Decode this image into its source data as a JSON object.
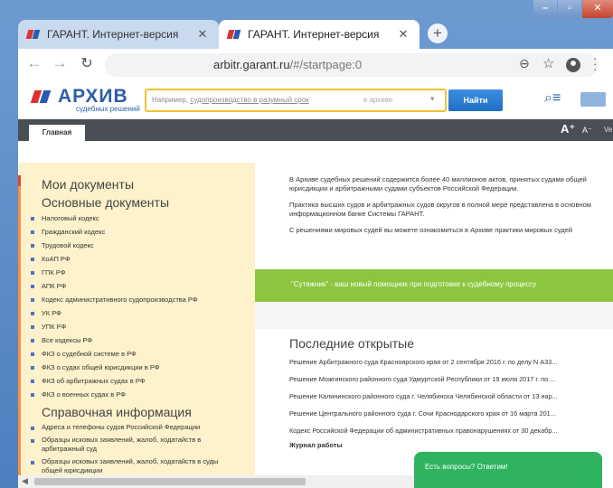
{
  "browser": {
    "tabs": [
      {
        "title": "ГАРАНТ. Интернет-версия",
        "active": false
      },
      {
        "title": "ГАРАНТ. Интернет-версия",
        "active": true
      }
    ],
    "close_glyph": "✕",
    "new_tab_glyph": "+",
    "url_host": "arbitr.garant.ru",
    "url_path": "/#/startpage:0"
  },
  "site": {
    "logo_title": "АРХИВ",
    "logo_subtitle": "судебных решений",
    "search_placeholder_prefix": "Например,",
    "search_placeholder_link": "судопроизводство в разумный срок",
    "search_scope": "в архиве",
    "find_button": "Найти",
    "main_tab": "Главная",
    "font_big": "A⁺",
    "font_small": "A⁻",
    "nav_more": "Ve"
  },
  "left": {
    "my_docs": "Мои документы",
    "main_docs": "Основные документы",
    "main_items": [
      "Налоговый кодекс",
      "Гражданский кодекс",
      "Трудовой кодекс",
      "КоАП РФ",
      "ГПК РФ",
      "АПК РФ",
      "Кодекс административного судопроизводства РФ",
      "УК РФ",
      "УПК РФ",
      "Все кодексы РФ",
      "ФКЗ о судебной системе в РФ",
      "ФКЗ о судах общей юрисдикции в РФ",
      "ФКЗ об арбитражных судах в РФ",
      "ФКЗ о военных судах в РФ"
    ],
    "ref_head": "Справочная информация",
    "ref_items": [
      "Адреса и телефоны судов Российской Федерации",
      "Образцы исковых заявлений, жалоб, ходатайств в арбитражный суд",
      "Образцы исковых заявлений, жалоб, ходатайств в суды общей юрисдикции"
    ]
  },
  "right": {
    "intro": [
      "В Архиве судебных решений содержится более 40 миллионов актов, принятых судами общей юрисдикции и арбитражными судами субъектов Российской Федерации.",
      "Практика высших судов и арбитражных судов округов в полной мере представлена в основном информационном банке Системы ГАРАНТ.",
      "С решениями мировых судей вы можете ознакомиться в Архиве практики мировых судей"
    ],
    "promo": "\"Сутяжник\" - ваш новый помощник при подготовке к судебному процессу",
    "recent_head": "Последние открытые",
    "recent_items": [
      "Решение Арбитражного суда Красноярского края от 2 сентября 2016 г. по делу N А33...",
      "Решение Можгинского районного суда Удмуртской Республики от 19 июля 2017 г. по ...",
      "Решение Калининского районного суда г. Челябинска Челябинской области от 13 нар...",
      "Решение Центрального районного суда г. Сочи Краснодарского края от 16 марта 201...",
      "Кодекс Российской Федерации об административных правонарушениях от 30 декабр..."
    ],
    "journal": "Журнал работы",
    "chat": "Есть вопросы? Ответим!"
  }
}
